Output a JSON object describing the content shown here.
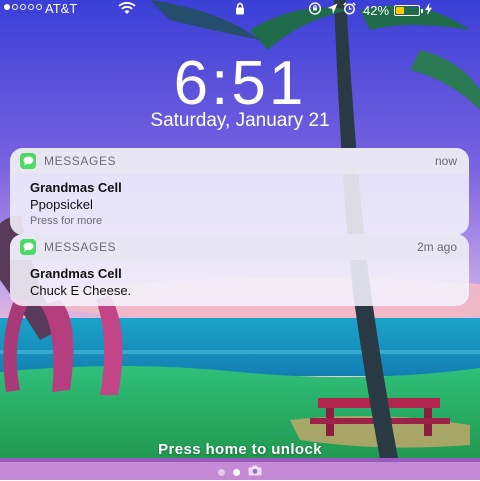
{
  "status_bar": {
    "signal_dots": [
      true,
      false,
      false,
      false,
      false
    ],
    "carrier": "AT&T",
    "battery_text": "42%",
    "battery_level": 0.42,
    "battery_color": "#ffcc00",
    "icons": [
      "wifi-icon",
      "lock-icon",
      "orientation-lock-icon",
      "location-icon",
      "alarm-icon",
      "charging-icon"
    ]
  },
  "lock_screen": {
    "time": "6:51",
    "date": "Saturday, January 21"
  },
  "notifications": [
    {
      "app": "MESSAGES",
      "app_icon": "messages-icon",
      "time": "now",
      "sender": "Grandmas Cell",
      "message": "Ppopsickel",
      "hint": "Press for more"
    },
    {
      "app": "MESSAGES",
      "app_icon": "messages-icon",
      "time": "2m ago",
      "sender": "Grandmas Cell",
      "message": "Chuck E Cheese."
    }
  ],
  "footer": {
    "unlock_text": "Press home to unlock",
    "page_indicator": [
      "dot",
      "dot-active",
      "camera-icon"
    ]
  }
}
